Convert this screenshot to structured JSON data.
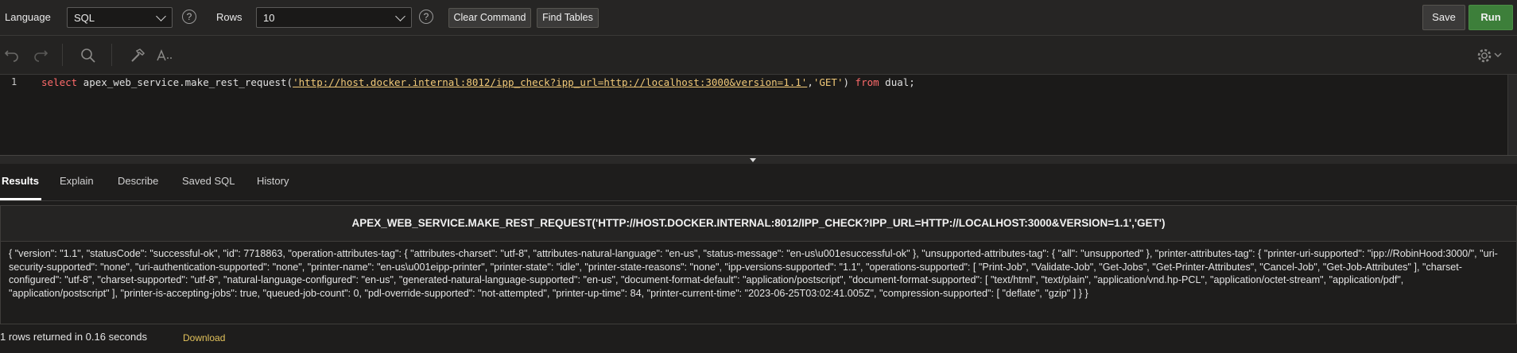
{
  "toolbar": {
    "language_label": "Language",
    "language_value": "SQL",
    "rows_label": "Rows",
    "rows_value": "10",
    "help_glyph": "?",
    "clear_command": "Clear Command",
    "find_tables": "Find Tables",
    "save": "Save",
    "run": "Run"
  },
  "editor_toolbar": {
    "icons": [
      "undo-icon",
      "redo-icon",
      "search-icon",
      "hammer-icon",
      "text-size-icon",
      "gear-icon",
      "chevron-down-icon"
    ]
  },
  "editor": {
    "line_number": "1",
    "tokens": {
      "select": "select",
      "fn": " apex_web_service.make_rest_request(",
      "url": "'http://host.docker.internal:8012/ipp_check?ipp_url=http://localhost:3000&version=1.1'",
      "comma": ",",
      "get": "'GET'",
      "paren": ") ",
      "from": "from",
      "dual": " dual;"
    }
  },
  "tabs": [
    "Results",
    "Explain",
    "Describe",
    "Saved SQL",
    "History"
  ],
  "results": {
    "column_header": "APEX_WEB_SERVICE.MAKE_REST_REQUEST('HTTP://HOST.DOCKER.INTERNAL:8012/IPP_CHECK?IPP_URL=HTTP://LOCALHOST:3000&VERSION=1.1','GET')",
    "cell_value": "{ \"version\": \"1.1\", \"statusCode\": \"successful-ok\", \"id\": 7718863, \"operation-attributes-tag\": { \"attributes-charset\": \"utf-8\", \"attributes-natural-language\": \"en-us\", \"status-message\": \"en-us\\u001esuccessful-ok\" }, \"unsupported-attributes-tag\": { \"all\": \"unsupported\" }, \"printer-attributes-tag\": { \"printer-uri-supported\": \"ipp://RobinHood:3000/\", \"uri-security-supported\": \"none\", \"uri-authentication-supported\": \"none\", \"printer-name\": \"en-us\\u001eipp-printer\", \"printer-state\": \"idle\", \"printer-state-reasons\": \"none\", \"ipp-versions-supported\": \"1.1\", \"operations-supported\": [ \"Print-Job\", \"Validate-Job\", \"Get-Jobs\", \"Get-Printer-Attributes\", \"Cancel-Job\", \"Get-Job-Attributes\" ], \"charset-configured\": \"utf-8\", \"charset-supported\": \"utf-8\", \"natural-language-configured\": \"en-us\", \"generated-natural-language-supported\": \"en-us\", \"document-format-default\": \"application/postscript\", \"document-format-supported\": [ \"text/html\", \"text/plain\", \"application/vnd.hp-PCL\", \"application/octet-stream\", \"application/pdf\", \"application/postscript\" ], \"printer-is-accepting-jobs\": true, \"queued-job-count\": 0, \"pdl-override-supported\": \"not-attempted\", \"printer-up-time\": 84, \"printer-current-time\": \"2023-06-25T03:02:41.005Z\", \"compression-supported\": [ \"deflate\", \"gzip\" ] } }"
  },
  "status": {
    "rows_text": "1 rows returned in 0.16 seconds",
    "download": "Download"
  }
}
